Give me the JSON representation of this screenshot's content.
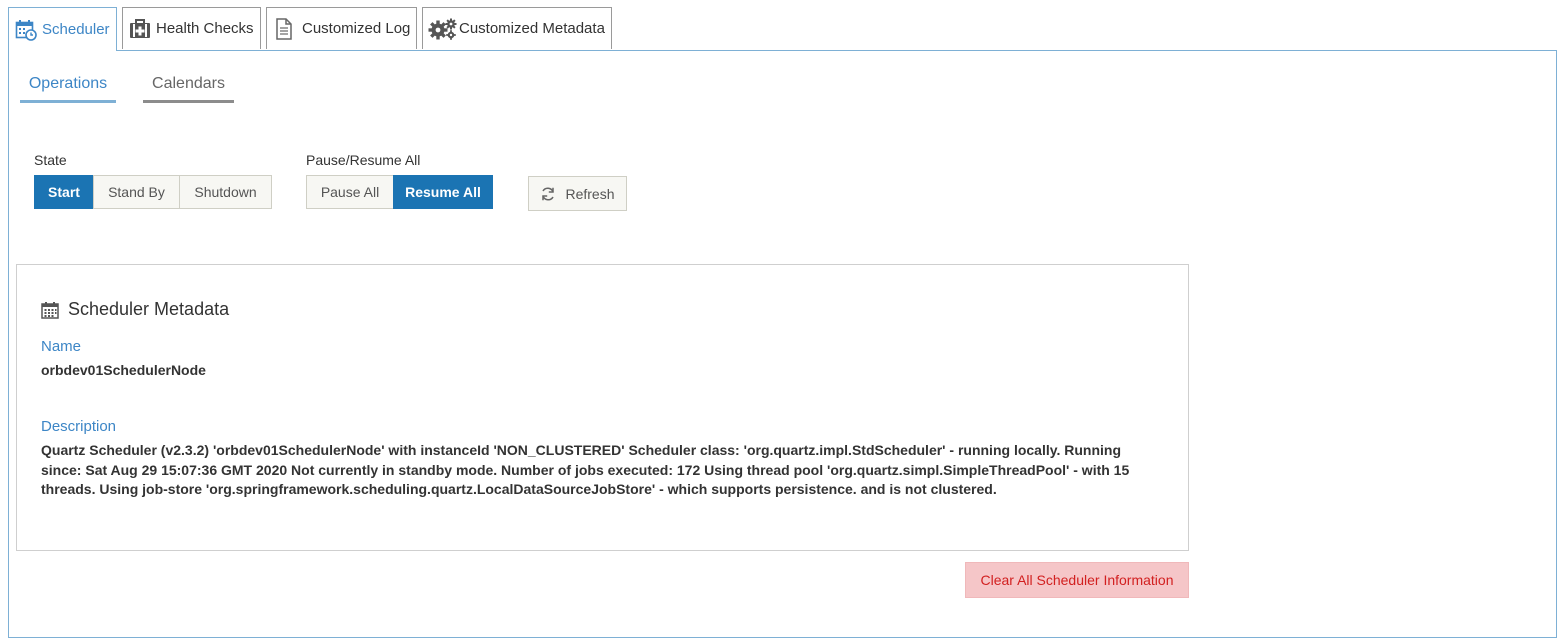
{
  "tabs": [
    {
      "label": "Scheduler",
      "icon": "calendar-clock-icon",
      "active": true
    },
    {
      "label": "Health Checks",
      "icon": "medical-kit-icon",
      "active": false
    },
    {
      "label": "Customized Log",
      "icon": "document-icon",
      "active": false
    },
    {
      "label": "Customized Metadata",
      "icon": "gears-icon",
      "active": false
    }
  ],
  "subtabs": [
    {
      "label": "Operations",
      "active": true
    },
    {
      "label": "Calendars",
      "active": false
    }
  ],
  "state": {
    "label": "State",
    "buttons": [
      "Start",
      "Stand By",
      "Shutdown"
    ],
    "selected": "Start"
  },
  "pause_resume": {
    "label": "Pause/Resume All",
    "buttons": [
      "Pause All",
      "Resume All"
    ],
    "selected": "Resume All"
  },
  "refresh_label": "Refresh",
  "metadata": {
    "title": "Scheduler Metadata",
    "name_label": "Name",
    "name_value": "orbdev01SchedulerNode",
    "description_label": "Description",
    "description_value": "Quartz Scheduler (v2.3.2) 'orbdev01SchedulerNode' with instanceId 'NON_CLUSTERED' Scheduler class: 'org.quartz.impl.StdScheduler' - running locally. Running since: Sat Aug 29 15:07:36 GMT 2020 Not currently in standby mode. Number of jobs executed: 172 Using thread pool 'org.quartz.simpl.SimpleThreadPool' - with 15 threads. Using job-store 'org.springframework.scheduling.quartz.LocalDataSourceJobStore' - which supports persistence. and is not clustered."
  },
  "clear_label": "Clear All Scheduler Information",
  "colors": {
    "accent": "#3d86c6",
    "active_button": "#1b74b3",
    "danger_bg": "#f5c6c8",
    "danger_text": "#d22020"
  }
}
